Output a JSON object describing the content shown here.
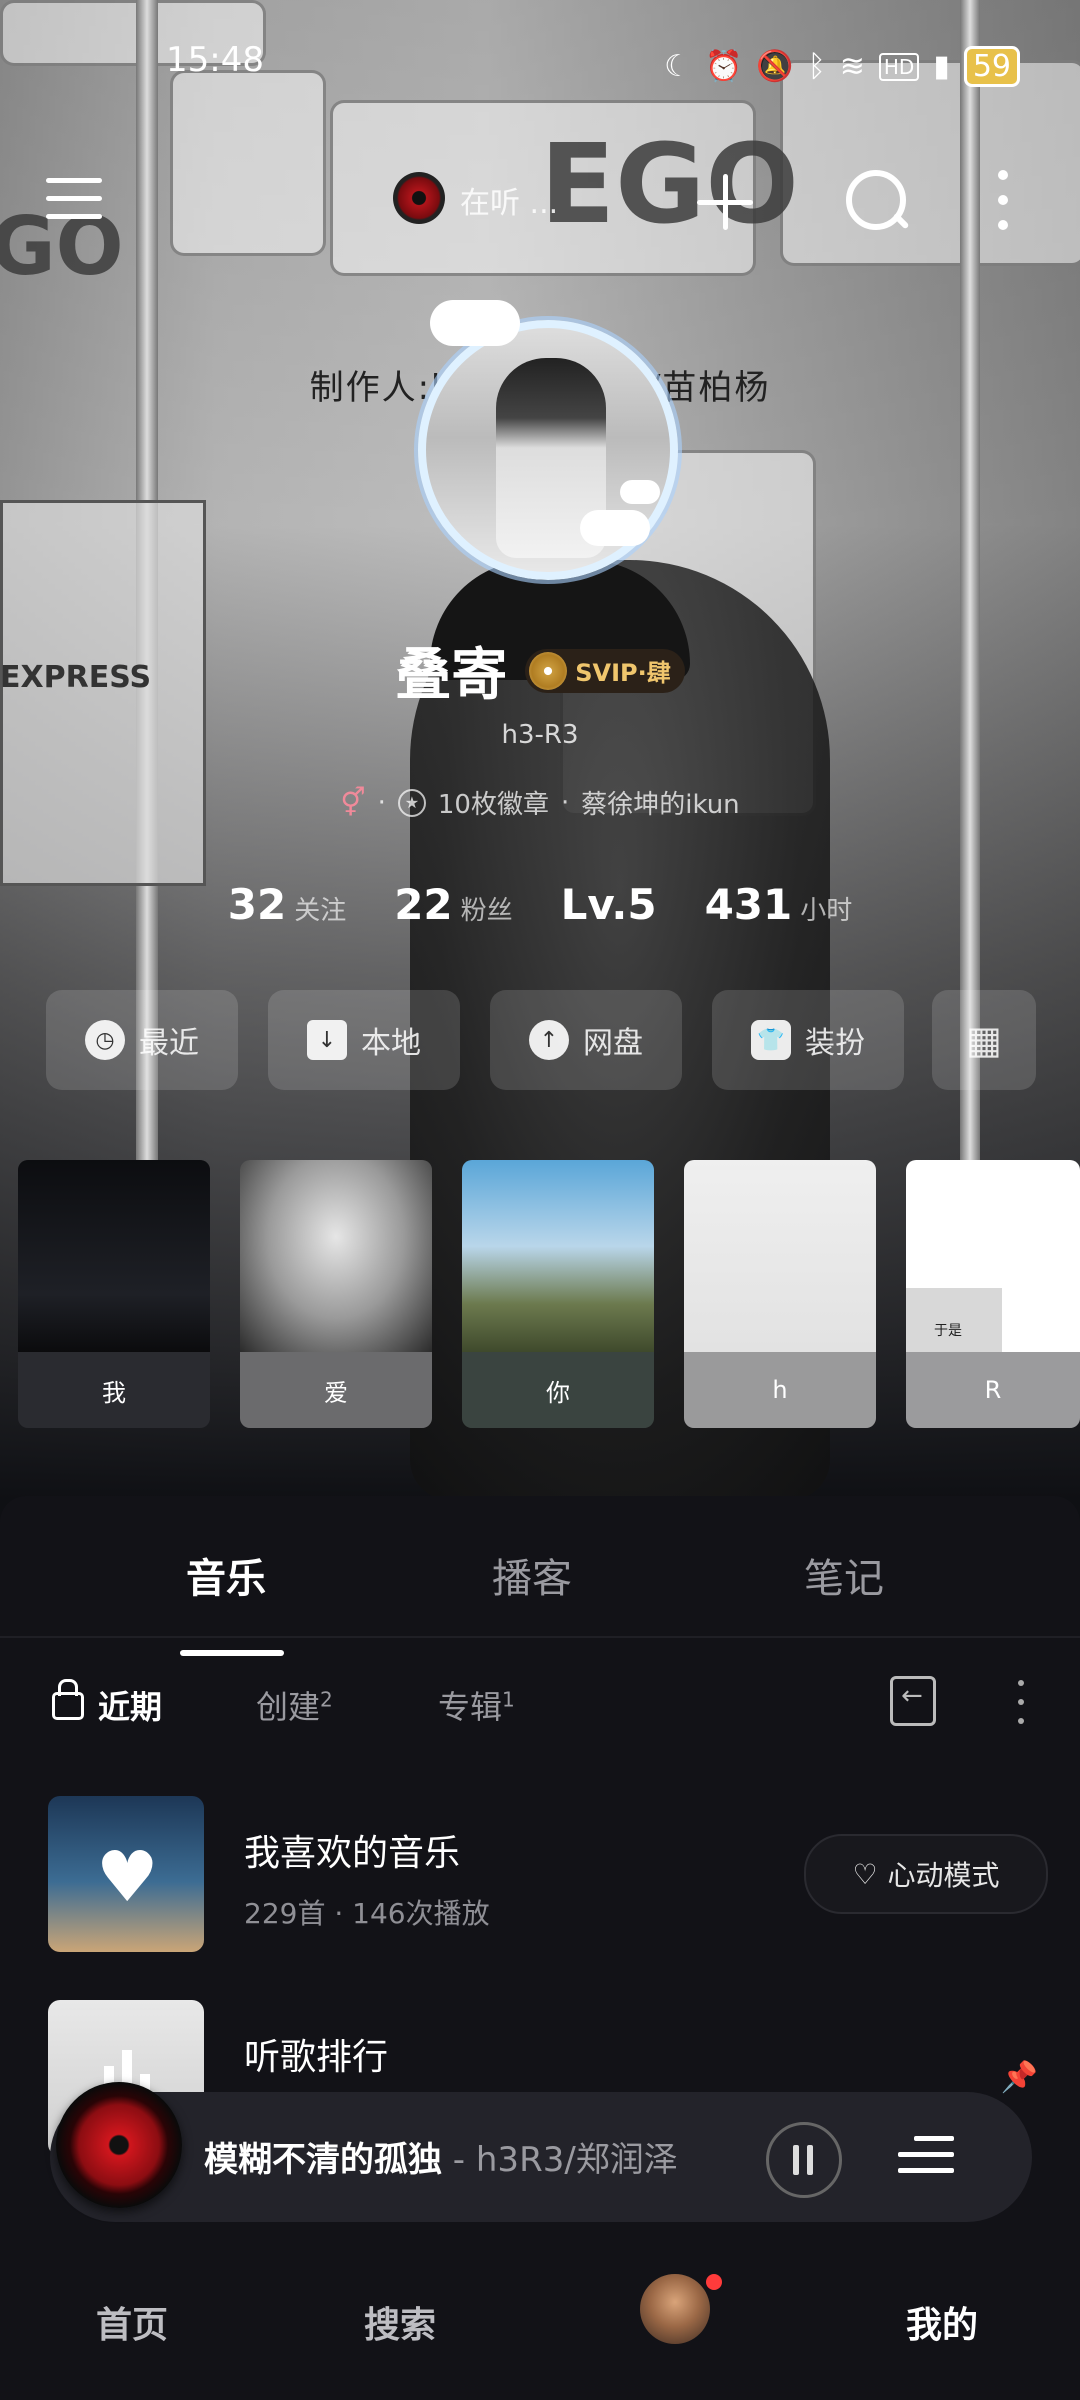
{
  "status_bar": {
    "time": "15:48",
    "icons": [
      "moon-icon",
      "alarm-icon",
      "mute-icon",
      "bluetooth-icon",
      "wifi-icon",
      "hd-icon",
      "signal-icon"
    ],
    "battery": "59"
  },
  "top_bar": {
    "now_playing_label": "在听 ..."
  },
  "profile": {
    "producer_line": "制作人:h3R3/郑润泽/苗柏杨",
    "nickname": "叠寄",
    "vip_label": "SVIP·肆",
    "user_id": "h3-R3",
    "meta_dot1": "·",
    "badges": "10枚徽章",
    "meta_dot2": "·",
    "tagline": "蔡徐坤的ikun"
  },
  "stats": [
    {
      "value": "32",
      "label": "关注"
    },
    {
      "value": "22",
      "label": "粉丝"
    },
    {
      "value": "Lv.5",
      "label": ""
    },
    {
      "value": "431",
      "label": "小时"
    }
  ],
  "shortcuts": [
    {
      "label": "最近",
      "icon": "clock-icon"
    },
    {
      "label": "本地",
      "icon": "download-icon"
    },
    {
      "label": "网盘",
      "icon": "cloud-upload-icon"
    },
    {
      "label": "装扮",
      "icon": "shirt-icon"
    },
    {
      "label": "",
      "icon": "grid-plus-icon"
    }
  ],
  "albums": [
    {
      "label": "我"
    },
    {
      "label": "爱"
    },
    {
      "label": "你"
    },
    {
      "label": "h"
    },
    {
      "label": "R",
      "art_text": "于是"
    }
  ],
  "tabs": [
    {
      "label": "音乐",
      "active": true
    },
    {
      "label": "播客",
      "active": false
    },
    {
      "label": "笔记",
      "active": false
    }
  ],
  "subtabs": [
    {
      "label": "近期",
      "count": ""
    },
    {
      "label": "创建",
      "count": "2"
    },
    {
      "label": "专辑",
      "count": "1"
    }
  ],
  "playlists": [
    {
      "title": "我喜欢的音乐",
      "subtitle": "229首 · 146次播放",
      "action": "心动模式"
    },
    {
      "title": "听歌排行",
      "subtitle": ""
    }
  ],
  "player": {
    "song": "模糊不清的孤独",
    "artist": " - h3R3/郑润泽"
  },
  "bottom_nav": [
    {
      "label": "首页"
    },
    {
      "label": "搜索"
    },
    {
      "label": ""
    },
    {
      "label": "我的"
    }
  ],
  "colors": {
    "background": "#0f1014",
    "panel": "#121217",
    "vip_gold": "#f0c66d",
    "notification_dot": "#ff3b3b"
  }
}
